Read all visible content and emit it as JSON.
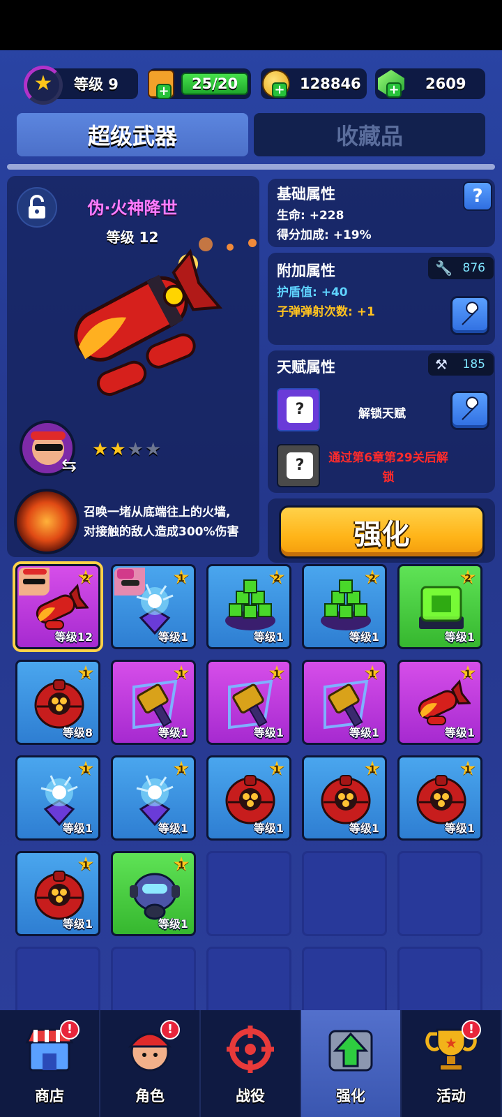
{
  "topbar": {
    "level_label": "等级 9",
    "energy": "25/20",
    "gold": "128846",
    "gems": "2609",
    "level_progress": 0.55
  },
  "tabs": [
    {
      "label": "超级武器",
      "active": true
    },
    {
      "label": "收藏品",
      "active": false
    }
  ],
  "weapon": {
    "name": "伪·火神降世",
    "level": "等级 12",
    "stars_filled": 2,
    "stars_total": 4,
    "skill_desc_line1": "召唤一堵从底端往上的火墙,",
    "skill_desc_line2": "对接触的敌人造成300%伤害"
  },
  "basic_attrs": {
    "title": "基础属性",
    "help": "?",
    "lines": [
      "生命: +228",
      "得分加成: +19%"
    ]
  },
  "extra_attrs": {
    "title": "附加属性",
    "cost": "876",
    "line1": "护盾值: +40",
    "line2": "子弹弹射次数: +1",
    "line1_color": "#5fd3ff",
    "line2_color": "#ffc21f"
  },
  "talent_attrs": {
    "title": "天赋属性",
    "cost": "185",
    "unlock_label": "解锁天赋",
    "locked_line1": "通过第6章第29关后解",
    "locked_line2": "锁",
    "locked_color": "#ff2b2b"
  },
  "enhance_button": "强化",
  "grid": [
    {
      "color": "purple",
      "art": "rocket",
      "badge": "2",
      "level": "等级12",
      "selected": true,
      "face": "shades"
    },
    {
      "color": "blue",
      "art": "crystal",
      "badge": "1",
      "level": "等级1",
      "face": "pink"
    },
    {
      "color": "blue",
      "art": "cubes",
      "badge": "2",
      "level": "等级1"
    },
    {
      "color": "blue",
      "art": "cubes",
      "badge": "2",
      "level": "等级1"
    },
    {
      "color": "green",
      "art": "cube",
      "badge": "2",
      "level": "等级1"
    },
    {
      "color": "blue",
      "art": "orb",
      "badge": "1",
      "level": "等级8"
    },
    {
      "color": "purple",
      "art": "hammer",
      "badge": "1",
      "level": "等级1"
    },
    {
      "color": "purple",
      "art": "hammer",
      "badge": "1",
      "level": "等级1"
    },
    {
      "color": "purple",
      "art": "hammer",
      "badge": "1",
      "level": "等级1"
    },
    {
      "color": "purple",
      "art": "rocket",
      "badge": "1",
      "level": "等级1"
    },
    {
      "color": "blue",
      "art": "crystal",
      "badge": "1",
      "level": "等级1"
    },
    {
      "color": "blue",
      "art": "crystal",
      "badge": "1",
      "level": "等级1"
    },
    {
      "color": "blue",
      "art": "orb",
      "badge": "1",
      "level": "等级1"
    },
    {
      "color": "blue",
      "art": "orb",
      "badge": "1",
      "level": "等级1"
    },
    {
      "color": "blue",
      "art": "orb",
      "badge": "1",
      "level": "等级1"
    },
    {
      "color": "blue",
      "art": "orb",
      "badge": "1",
      "level": "等级1"
    },
    {
      "color": "green",
      "art": "drone",
      "badge": "1",
      "level": "等级1"
    },
    {
      "color": "empty"
    },
    {
      "color": "empty"
    },
    {
      "color": "empty"
    },
    {
      "color": "empty"
    },
    {
      "color": "empty"
    },
    {
      "color": "empty"
    },
    {
      "color": "empty"
    },
    {
      "color": "empty"
    }
  ],
  "nav": [
    {
      "label": "商店",
      "icon": "shop-icon",
      "alert": "!"
    },
    {
      "label": "角色",
      "icon": "character-icon",
      "alert": "!"
    },
    {
      "label": "战役",
      "icon": "crosshair-icon"
    },
    {
      "label": "强化",
      "icon": "upgrade-icon",
      "active": true
    },
    {
      "label": "活动",
      "icon": "trophy-icon",
      "alert": "!"
    }
  ]
}
